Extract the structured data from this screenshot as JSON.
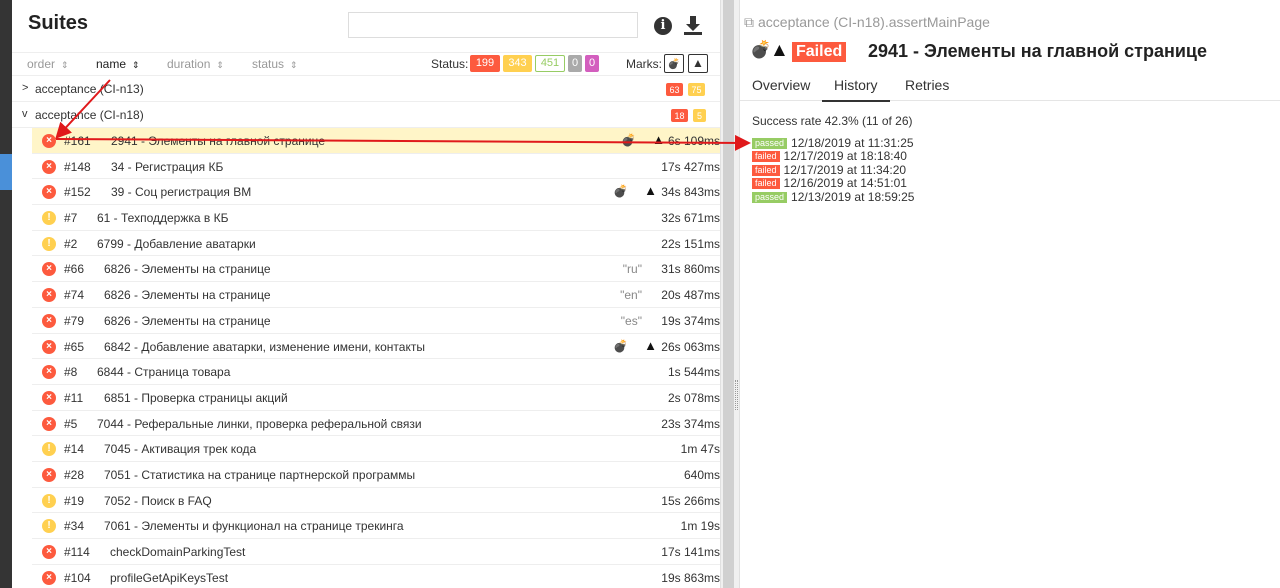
{
  "suites": {
    "title": "Suites",
    "search_placeholder": "",
    "info_icon": "info-icon",
    "download_icon": "download-icon"
  },
  "sort": {
    "order": "order",
    "name": "name",
    "duration": "duration",
    "status": "status"
  },
  "status_filter": {
    "label": "Status:",
    "failed": "199",
    "broken": "343",
    "passed": "451",
    "skipped": "0",
    "unknown": "0"
  },
  "marks": {
    "label": "Marks:",
    "flaky_glyph": "💣",
    "new_failed_glyph": "▲"
  },
  "groups": [
    {
      "title": "acceptance (CI-n13)",
      "chev": ">",
      "failed": "63",
      "broken": "75"
    },
    {
      "title": "acceptance (CI-n18)",
      "chev": "v",
      "failed": "18",
      "broken": "5"
    }
  ],
  "rows": [
    {
      "status": "failed",
      "num": "#161",
      "name": "2941 - Элементы на главной странице",
      "param": "",
      "duration": "6s 109ms",
      "flaky": true,
      "newfail": true
    },
    {
      "status": "failed",
      "num": "#148",
      "name": "34 - Регистрация КБ",
      "param": "",
      "duration": "17s 427ms",
      "flaky": false,
      "newfail": false
    },
    {
      "status": "failed",
      "num": "#152",
      "name": "39 - Соц регистрация ВМ",
      "param": "",
      "duration": "34s 843ms",
      "flaky": true,
      "newfail": true
    },
    {
      "status": "broken",
      "num": "#7",
      "name": "61 - Техподдержка в КБ",
      "param": "",
      "duration": "32s 671ms",
      "flaky": false,
      "newfail": false
    },
    {
      "status": "broken",
      "num": "#2",
      "name": "6799 - Добавление аватарки",
      "param": "",
      "duration": "22s 151ms",
      "flaky": false,
      "newfail": false
    },
    {
      "status": "failed",
      "num": "#66",
      "name": "6826 - Элементы на странице",
      "param": "\"ru\"",
      "duration": "31s 860ms",
      "flaky": false,
      "newfail": false
    },
    {
      "status": "failed",
      "num": "#74",
      "name": "6826 - Элементы на странице",
      "param": "\"en\"",
      "duration": "20s 487ms",
      "flaky": false,
      "newfail": false
    },
    {
      "status": "failed",
      "num": "#79",
      "name": "6826 - Элементы на странице",
      "param": "\"es\"",
      "duration": "19s 374ms",
      "flaky": false,
      "newfail": false
    },
    {
      "status": "failed",
      "num": "#65",
      "name": "6842 - Добавление аватарки, изменение имени, контакты",
      "param": "",
      "duration": "26s 063ms",
      "flaky": true,
      "newfail": true
    },
    {
      "status": "failed",
      "num": "#8",
      "name": "6844 - Страница товара",
      "param": "",
      "duration": "1s 544ms",
      "flaky": false,
      "newfail": false
    },
    {
      "status": "failed",
      "num": "#11",
      "name": "6851 - Проверка страницы акций",
      "param": "",
      "duration": "2s 078ms",
      "flaky": false,
      "newfail": false
    },
    {
      "status": "failed",
      "num": "#5",
      "name": "7044 - Реферальные линки, проверка реферальной связи",
      "param": "",
      "duration": "23s 374ms",
      "flaky": false,
      "newfail": false
    },
    {
      "status": "broken",
      "num": "#14",
      "name": "7045 - Активация трек кода",
      "param": "",
      "duration": "1m 47s",
      "flaky": false,
      "newfail": false
    },
    {
      "status": "failed",
      "num": "#28",
      "name": "7051 - Статистика на странице партнерской программы",
      "param": "",
      "duration": "640ms",
      "flaky": false,
      "newfail": false
    },
    {
      "status": "broken",
      "num": "#19",
      "name": "7052 - Поиск в FAQ",
      "param": "",
      "duration": "15s 266ms",
      "flaky": false,
      "newfail": false
    },
    {
      "status": "broken",
      "num": "#34",
      "name": "7061 - Элементы и функционал на странице трекинга",
      "param": "",
      "duration": "1m 19s",
      "flaky": false,
      "newfail": false
    },
    {
      "status": "failed",
      "num": "#114",
      "name": "checkDomainParkingTest",
      "param": "",
      "duration": "17s 141ms",
      "flaky": false,
      "newfail": false
    },
    {
      "status": "failed",
      "num": "#104",
      "name": "profileGetApiKeysTest",
      "param": "",
      "duration": "19s 863ms",
      "flaky": false,
      "newfail": false
    }
  ],
  "detail": {
    "path": "acceptance (CI-n18).assertMainPage",
    "status_label": "Failed",
    "title": "2941 - Элементы на главной странице",
    "tabs": [
      "Overview",
      "History",
      "Retries"
    ],
    "active_tab": "History",
    "success_rate": "Success rate 42.3% (11 of 26)",
    "history": [
      {
        "status": "passed",
        "date": "12/18/2019 at 11:31:25"
      },
      {
        "status": "failed",
        "date": "12/17/2019 at 18:18:40"
      },
      {
        "status": "failed",
        "date": "12/17/2019 at 11:34:20"
      },
      {
        "status": "failed",
        "date": "12/16/2019 at 14:51:01"
      },
      {
        "status": "passed",
        "date": "12/13/2019 at 18:59:25"
      }
    ]
  },
  "colors": {
    "failed": "#fd5a3e",
    "broken": "#ffd050",
    "passed": "#97cc64",
    "selected_row": "#fff5c8",
    "annotation_arrow": "#e0191b"
  }
}
